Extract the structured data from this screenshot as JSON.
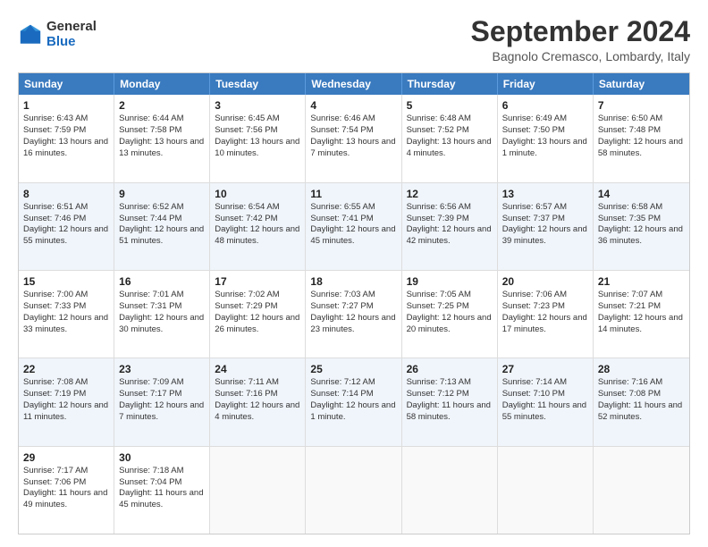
{
  "logo": {
    "general": "General",
    "blue": "Blue"
  },
  "header": {
    "month": "September 2024",
    "location": "Bagnolo Cremasco, Lombardy, Italy"
  },
  "days": [
    "Sunday",
    "Monday",
    "Tuesday",
    "Wednesday",
    "Thursday",
    "Friday",
    "Saturday"
  ],
  "weeks": [
    [
      {
        "day": 1,
        "sunrise": "6:43 AM",
        "sunset": "7:59 PM",
        "daylight": "13 hours and 16 minutes."
      },
      {
        "day": 2,
        "sunrise": "6:44 AM",
        "sunset": "7:58 PM",
        "daylight": "13 hours and 13 minutes."
      },
      {
        "day": 3,
        "sunrise": "6:45 AM",
        "sunset": "7:56 PM",
        "daylight": "13 hours and 10 minutes."
      },
      {
        "day": 4,
        "sunrise": "6:46 AM",
        "sunset": "7:54 PM",
        "daylight": "13 hours and 7 minutes."
      },
      {
        "day": 5,
        "sunrise": "6:48 AM",
        "sunset": "7:52 PM",
        "daylight": "13 hours and 4 minutes."
      },
      {
        "day": 6,
        "sunrise": "6:49 AM",
        "sunset": "7:50 PM",
        "daylight": "13 hours and 1 minute."
      },
      {
        "day": 7,
        "sunrise": "6:50 AM",
        "sunset": "7:48 PM",
        "daylight": "12 hours and 58 minutes."
      }
    ],
    [
      {
        "day": 8,
        "sunrise": "6:51 AM",
        "sunset": "7:46 PM",
        "daylight": "12 hours and 55 minutes."
      },
      {
        "day": 9,
        "sunrise": "6:52 AM",
        "sunset": "7:44 PM",
        "daylight": "12 hours and 51 minutes."
      },
      {
        "day": 10,
        "sunrise": "6:54 AM",
        "sunset": "7:42 PM",
        "daylight": "12 hours and 48 minutes."
      },
      {
        "day": 11,
        "sunrise": "6:55 AM",
        "sunset": "7:41 PM",
        "daylight": "12 hours and 45 minutes."
      },
      {
        "day": 12,
        "sunrise": "6:56 AM",
        "sunset": "7:39 PM",
        "daylight": "12 hours and 42 minutes."
      },
      {
        "day": 13,
        "sunrise": "6:57 AM",
        "sunset": "7:37 PM",
        "daylight": "12 hours and 39 minutes."
      },
      {
        "day": 14,
        "sunrise": "6:58 AM",
        "sunset": "7:35 PM",
        "daylight": "12 hours and 36 minutes."
      }
    ],
    [
      {
        "day": 15,
        "sunrise": "7:00 AM",
        "sunset": "7:33 PM",
        "daylight": "12 hours and 33 minutes."
      },
      {
        "day": 16,
        "sunrise": "7:01 AM",
        "sunset": "7:31 PM",
        "daylight": "12 hours and 30 minutes."
      },
      {
        "day": 17,
        "sunrise": "7:02 AM",
        "sunset": "7:29 PM",
        "daylight": "12 hours and 26 minutes."
      },
      {
        "day": 18,
        "sunrise": "7:03 AM",
        "sunset": "7:27 PM",
        "daylight": "12 hours and 23 minutes."
      },
      {
        "day": 19,
        "sunrise": "7:05 AM",
        "sunset": "7:25 PM",
        "daylight": "12 hours and 20 minutes."
      },
      {
        "day": 20,
        "sunrise": "7:06 AM",
        "sunset": "7:23 PM",
        "daylight": "12 hours and 17 minutes."
      },
      {
        "day": 21,
        "sunrise": "7:07 AM",
        "sunset": "7:21 PM",
        "daylight": "12 hours and 14 minutes."
      }
    ],
    [
      {
        "day": 22,
        "sunrise": "7:08 AM",
        "sunset": "7:19 PM",
        "daylight": "12 hours and 11 minutes."
      },
      {
        "day": 23,
        "sunrise": "7:09 AM",
        "sunset": "7:17 PM",
        "daylight": "12 hours and 7 minutes."
      },
      {
        "day": 24,
        "sunrise": "7:11 AM",
        "sunset": "7:16 PM",
        "daylight": "12 hours and 4 minutes."
      },
      {
        "day": 25,
        "sunrise": "7:12 AM",
        "sunset": "7:14 PM",
        "daylight": "12 hours and 1 minute."
      },
      {
        "day": 26,
        "sunrise": "7:13 AM",
        "sunset": "7:12 PM",
        "daylight": "11 hours and 58 minutes."
      },
      {
        "day": 27,
        "sunrise": "7:14 AM",
        "sunset": "7:10 PM",
        "daylight": "11 hours and 55 minutes."
      },
      {
        "day": 28,
        "sunrise": "7:16 AM",
        "sunset": "7:08 PM",
        "daylight": "11 hours and 52 minutes."
      }
    ],
    [
      {
        "day": 29,
        "sunrise": "7:17 AM",
        "sunset": "7:06 PM",
        "daylight": "11 hours and 49 minutes."
      },
      {
        "day": 30,
        "sunrise": "7:18 AM",
        "sunset": "7:04 PM",
        "daylight": "11 hours and 45 minutes."
      },
      null,
      null,
      null,
      null,
      null
    ]
  ]
}
